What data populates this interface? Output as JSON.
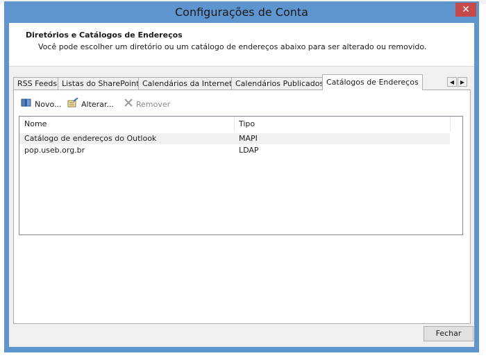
{
  "dialog": {
    "title": "Configurações de Conta",
    "close_symbol": "✕"
  },
  "header": {
    "title": "Diretórios e Catálogos de Endereços",
    "description": "Você pode escolher um diretório ou um catálogo de endereços abaixo para ser alterado ou removido."
  },
  "tabs": [
    {
      "label": "RSS Feeds"
    },
    {
      "label": "Listas do SharePoint"
    },
    {
      "label": "Calendários da Internet"
    },
    {
      "label": "Calendários Publicados"
    },
    {
      "label": "Catálogos de Endereços"
    }
  ],
  "active_tab": "Catálogos de Endereços",
  "toolbar": {
    "new_label": "Novo...",
    "change_label": "Alterar...",
    "remove_label": "Remover",
    "icons": {
      "new": "address-book-icon",
      "change": "edit-card-icon",
      "remove": "x-icon"
    }
  },
  "list": {
    "columns": [
      "Nome",
      "Tipo"
    ],
    "rows": [
      {
        "name": "Catálogo de endereços do Outlook",
        "type": "MAPI",
        "selected": true
      },
      {
        "name": "pop.useb.org.br",
        "type": "LDAP",
        "selected": false
      }
    ]
  },
  "footer": {
    "close_label": "Fechar"
  },
  "colors": {
    "title_bar": "#5e95cf",
    "close_button": "#c74a4a",
    "panel_bg": "#f0f0f0"
  }
}
